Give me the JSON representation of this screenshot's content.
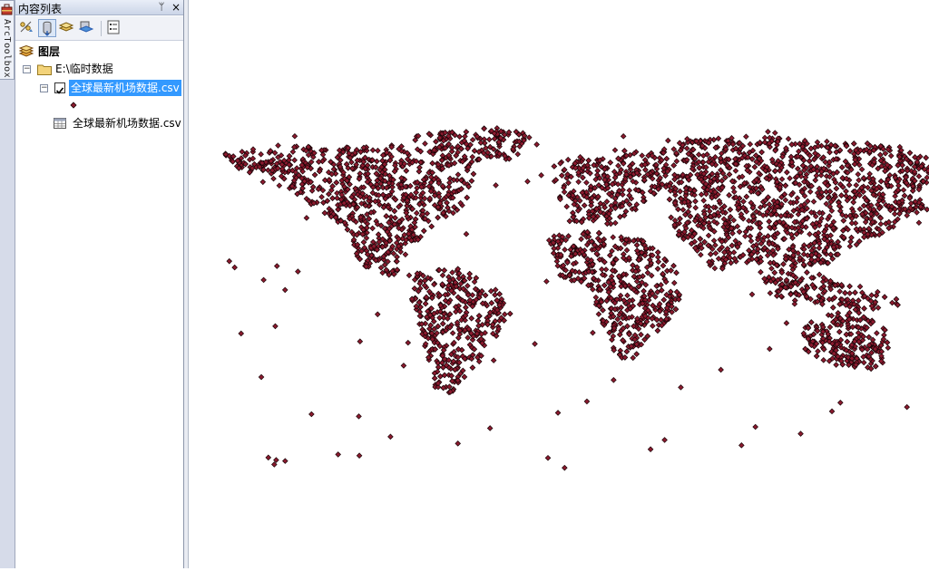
{
  "toolbox": {
    "label": "ArcToolbox"
  },
  "toc": {
    "title": "内容列表",
    "pin_glyph": "ᛘ",
    "close_glyph": "×",
    "tree": {
      "root_label": "图层",
      "folder_label": "E:\\临时数据",
      "layer_label": "全球最新机场数据.csv",
      "layer_checked": true,
      "table_label": "全球最新机场数据.csv"
    }
  },
  "map": {
    "symbol_fill": "#8b1a2e",
    "symbol_outline": "#1a0508"
  }
}
